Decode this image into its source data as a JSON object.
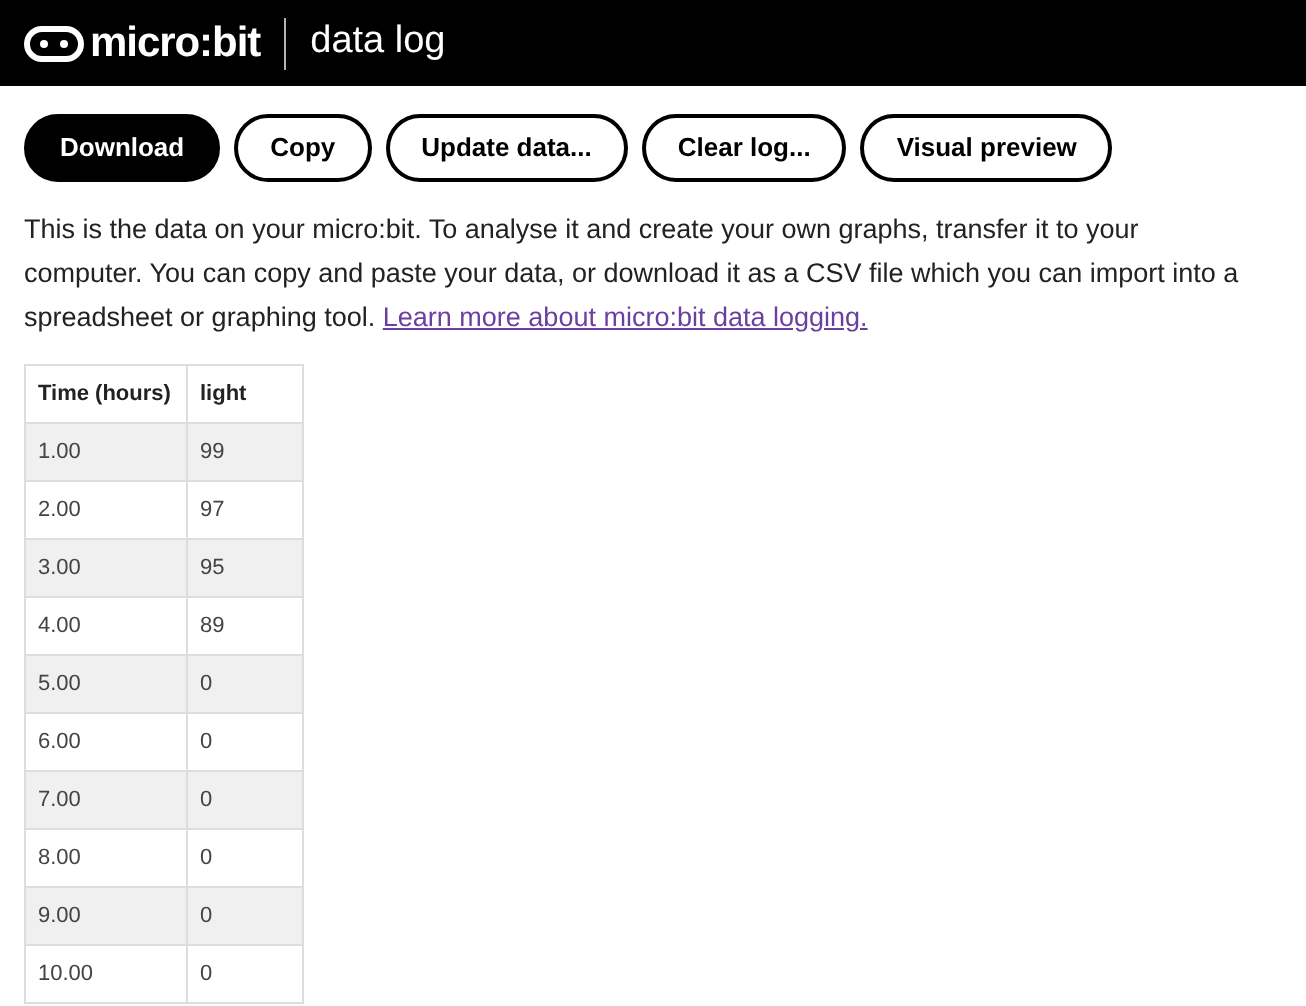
{
  "header": {
    "logo": "micro:bit",
    "title": "data log"
  },
  "buttons": [
    {
      "label": "Download",
      "primary": true
    },
    {
      "label": "Copy",
      "primary": false
    },
    {
      "label": "Update data...",
      "primary": false
    },
    {
      "label": "Clear log...",
      "primary": false
    },
    {
      "label": "Visual preview",
      "primary": false
    }
  ],
  "intro": {
    "text": "This is the data on your micro:bit. To analyse it and create your own graphs, transfer it to your computer. You can copy and paste your data, or download it as a CSV file which you can import into a spreadsheet or graphing tool.",
    "link": "Learn more about micro:bit data logging."
  },
  "table": {
    "columns": [
      "Time (hours)",
      "light"
    ],
    "rows": [
      [
        "1.00",
        "99"
      ],
      [
        "2.00",
        "97"
      ],
      [
        "3.00",
        "95"
      ],
      [
        "4.00",
        "89"
      ],
      [
        "5.00",
        "0"
      ],
      [
        "6.00",
        "0"
      ],
      [
        "7.00",
        "0"
      ],
      [
        "8.00",
        "0"
      ],
      [
        "9.00",
        "0"
      ],
      [
        "10.00",
        "0"
      ]
    ]
  }
}
